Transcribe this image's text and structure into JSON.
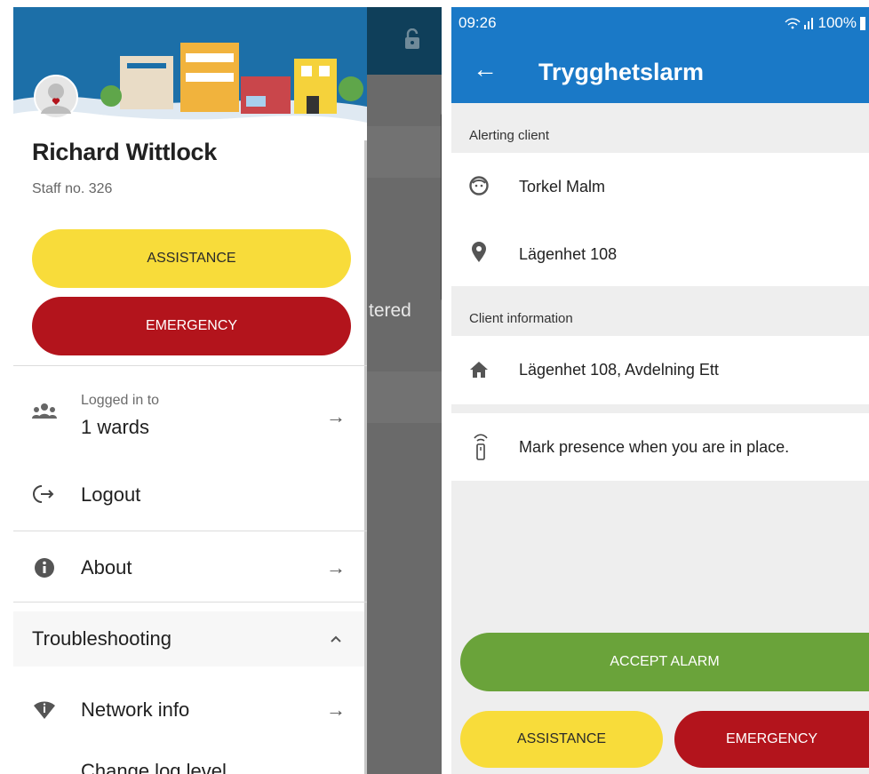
{
  "left": {
    "profile": {
      "name": "Richard Wittlock",
      "staff": "Staff no. 326"
    },
    "buttons": {
      "assistance": "ASSISTANCE",
      "emergency": "EMERGENCY"
    },
    "menu": {
      "wards_small": "Logged in to",
      "wards": "1 wards",
      "logout": "Logout",
      "about": "About",
      "troubleshooting": "Troubleshooting",
      "network_info": "Network info",
      "change_log_level": "Change log level"
    },
    "background_text": "tered"
  },
  "right": {
    "status": {
      "time": "09:26",
      "signal": "100%"
    },
    "title": "Trygghetslarm",
    "alerting_client_header": "Alerting client",
    "client_name": "Torkel Malm",
    "client_location": "Lägenhet 108",
    "client_info_header": "Client information",
    "client_address": "Lägenhet 108, Avdelning Ett",
    "presence_text": "Mark presence when you are in place.",
    "buttons": {
      "accept": "ACCEPT ALARM",
      "assistance": "ASSISTANCE",
      "emergency": "EMERGENCY"
    }
  },
  "colors": {
    "yellow": "#f8dc3a",
    "red": "#b3141c",
    "green": "#6aa33a",
    "blue": "#1a79c7"
  }
}
